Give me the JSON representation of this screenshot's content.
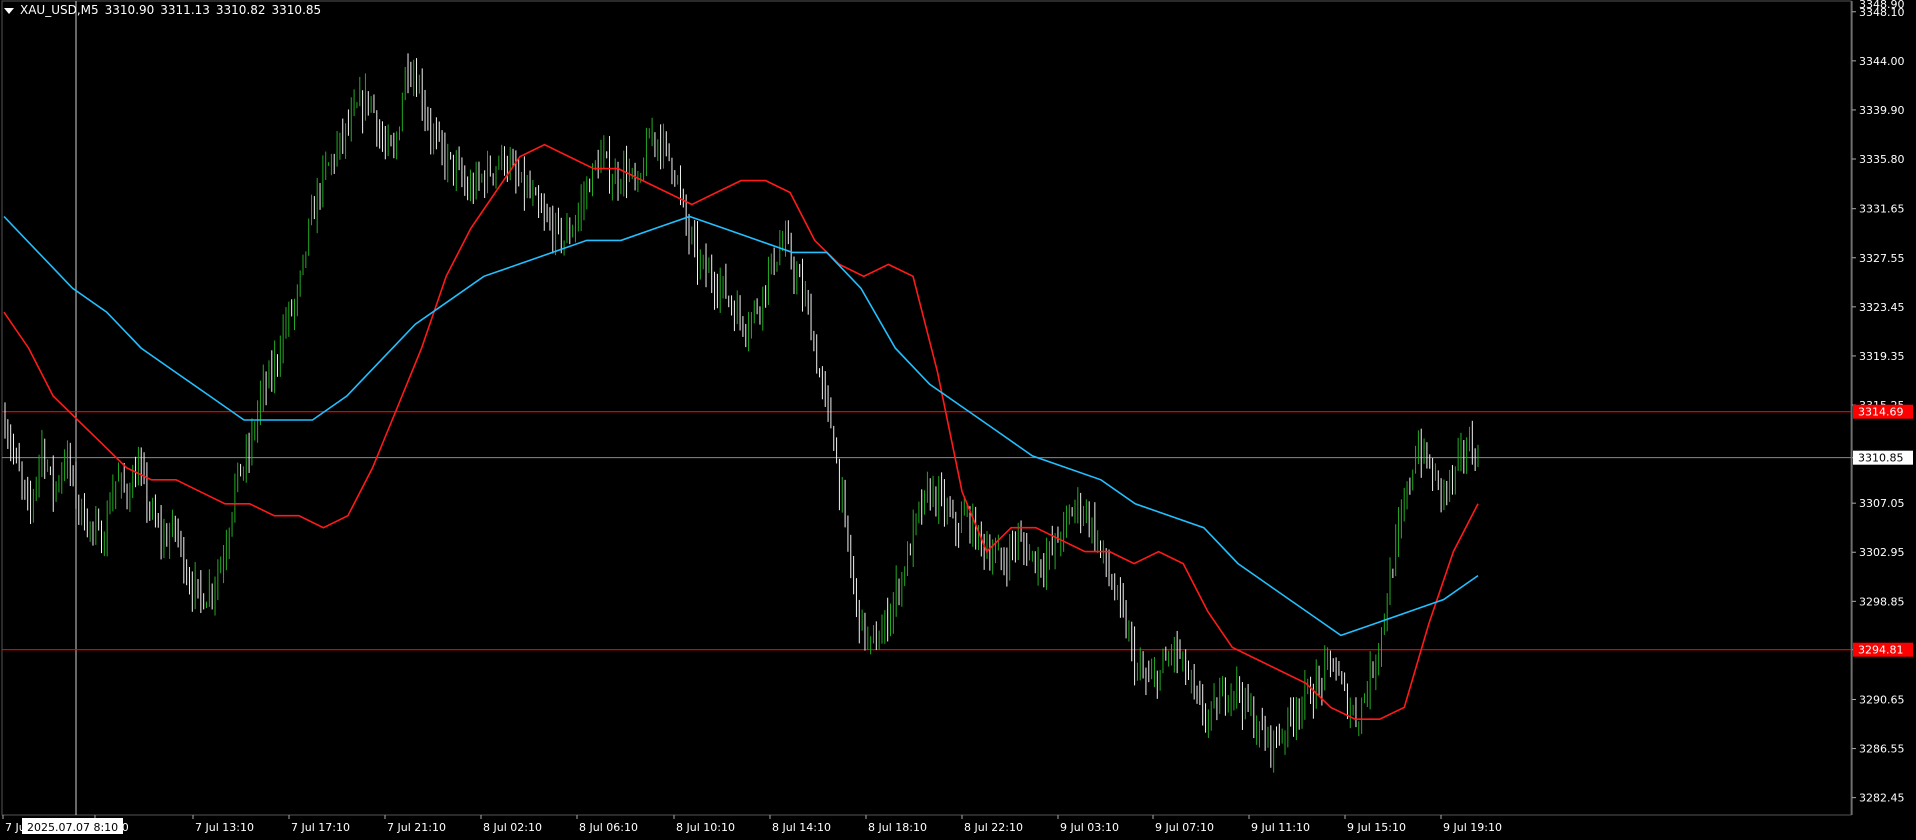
{
  "header": {
    "symbol": "XAU_USD,M5",
    "open": "3310.90",
    "high": "3311.13",
    "low": "3310.82",
    "close": "3310.85"
  },
  "crosshair_label": "2025.07.07 8:10",
  "colors": {
    "background": "#000000",
    "bull": "#22aa22",
    "bear": "#f2f2f2",
    "ma_fast": "#ff1a1a",
    "ma_slow": "#22c0ff",
    "level_line": "#ff0000",
    "bid_line": "#7f8c99"
  },
  "chart_data": {
    "type": "line",
    "title": "",
    "ylim": [
      3281.0,
      3349.0
    ],
    "y_ticks": [
      "3348.10",
      "3344.00",
      "3339.90",
      "3335.80",
      "3331.65",
      "3327.55",
      "3323.45",
      "3319.35",
      "3315.25",
      "3310.85",
      "3307.05",
      "3302.95",
      "3298.85",
      "3294.81",
      "3290.65",
      "3286.55",
      "3282.45"
    ],
    "y_top_label": "3348.90",
    "x_labels": [
      "7 Jul",
      "09:10",
      "7 Jul 13:10",
      "7 Jul 17:10",
      "7 Jul 21:10",
      "8 Jul 02:10",
      "8 Jul 06:10",
      "8 Jul 10:10",
      "8 Jul 14:10",
      "8 Jul 18:10",
      "8 Jul 22:10",
      "9 Jul 03:10",
      "9 Jul 07:10",
      "9 Jul 11:10",
      "9 Jul 15:10",
      "9 Jul 19:10"
    ],
    "levels": [
      {
        "value": 3314.69,
        "label": "3314.69"
      },
      {
        "value": 3294.81,
        "label": "3294.81"
      }
    ],
    "bid": {
      "value": 3310.85,
      "label": "3310.85"
    },
    "price_path": [
      3314,
      3310,
      3306,
      3312,
      3308,
      3311,
      3307,
      3305,
      3304,
      3309,
      3308,
      3310,
      3306,
      3304,
      3305,
      3301,
      3299,
      3300,
      3303,
      3309,
      3311,
      3316,
      3318,
      3322,
      3324,
      3330,
      3334,
      3336,
      3338,
      3340,
      3341,
      3337,
      3336,
      3344,
      3342,
      3338,
      3336,
      3335,
      3333,
      3334,
      3335,
      3336,
      3334,
      3333,
      3331,
      3330,
      3329,
      3331,
      3334,
      3336,
      3334,
      3335,
      3333,
      3338,
      3337,
      3335,
      3330,
      3327,
      3326,
      3325,
      3323,
      3322,
      3324,
      3327,
      3329,
      3326,
      3323,
      3317,
      3313,
      3305,
      3298,
      3295,
      3296,
      3299,
      3302,
      3306,
      3308,
      3307,
      3305,
      3306,
      3304,
      3303,
      3302,
      3304,
      3303,
      3302,
      3303,
      3305,
      3307,
      3306,
      3303,
      3300,
      3297,
      3293,
      3292,
      3293,
      3295,
      3293,
      3290,
      3289,
      3291,
      3292,
      3290,
      3288,
      3287,
      3288,
      3290,
      3291,
      3292,
      3294,
      3291,
      3289,
      3292,
      3296,
      3302,
      3307,
      3312,
      3310,
      3308,
      3309,
      3312,
      3311
    ],
    "series": [
      {
        "values": [
          3323,
          3320,
          3316,
          3314,
          3312,
          3310,
          3309,
          3309,
          3308,
          3307,
          3307,
          3306,
          3306,
          3305,
          3306,
          3310,
          3315,
          3320,
          3326,
          3330,
          3333,
          3336,
          3337,
          3336,
          3335,
          3335,
          3334,
          3333,
          3332,
          3333,
          3334,
          3334,
          3333,
          3329,
          3327,
          3326,
          3327,
          3326,
          3318,
          3308,
          3303,
          3305,
          3305,
          3304,
          3303,
          3303,
          3302,
          3303,
          3302,
          3298,
          3295,
          3294,
          3293,
          3292,
          3290,
          3289,
          3289,
          3290,
          3297,
          3303,
          3307
        ]
      },
      {
        "values": [
          3331,
          3328,
          3325,
          3323,
          3320,
          3318,
          3316,
          3314,
          3314,
          3314,
          3316,
          3319,
          3322,
          3324,
          3326,
          3327,
          3328,
          3329,
          3329,
          3330,
          3331,
          3330,
          3329,
          3328,
          3328,
          3325,
          3320,
          3317,
          3315,
          3313,
          3311,
          3310,
          3309,
          3307,
          3306,
          3305,
          3302,
          3300,
          3298,
          3296,
          3297,
          3298,
          3299,
          3301
        ]
      }
    ]
  }
}
